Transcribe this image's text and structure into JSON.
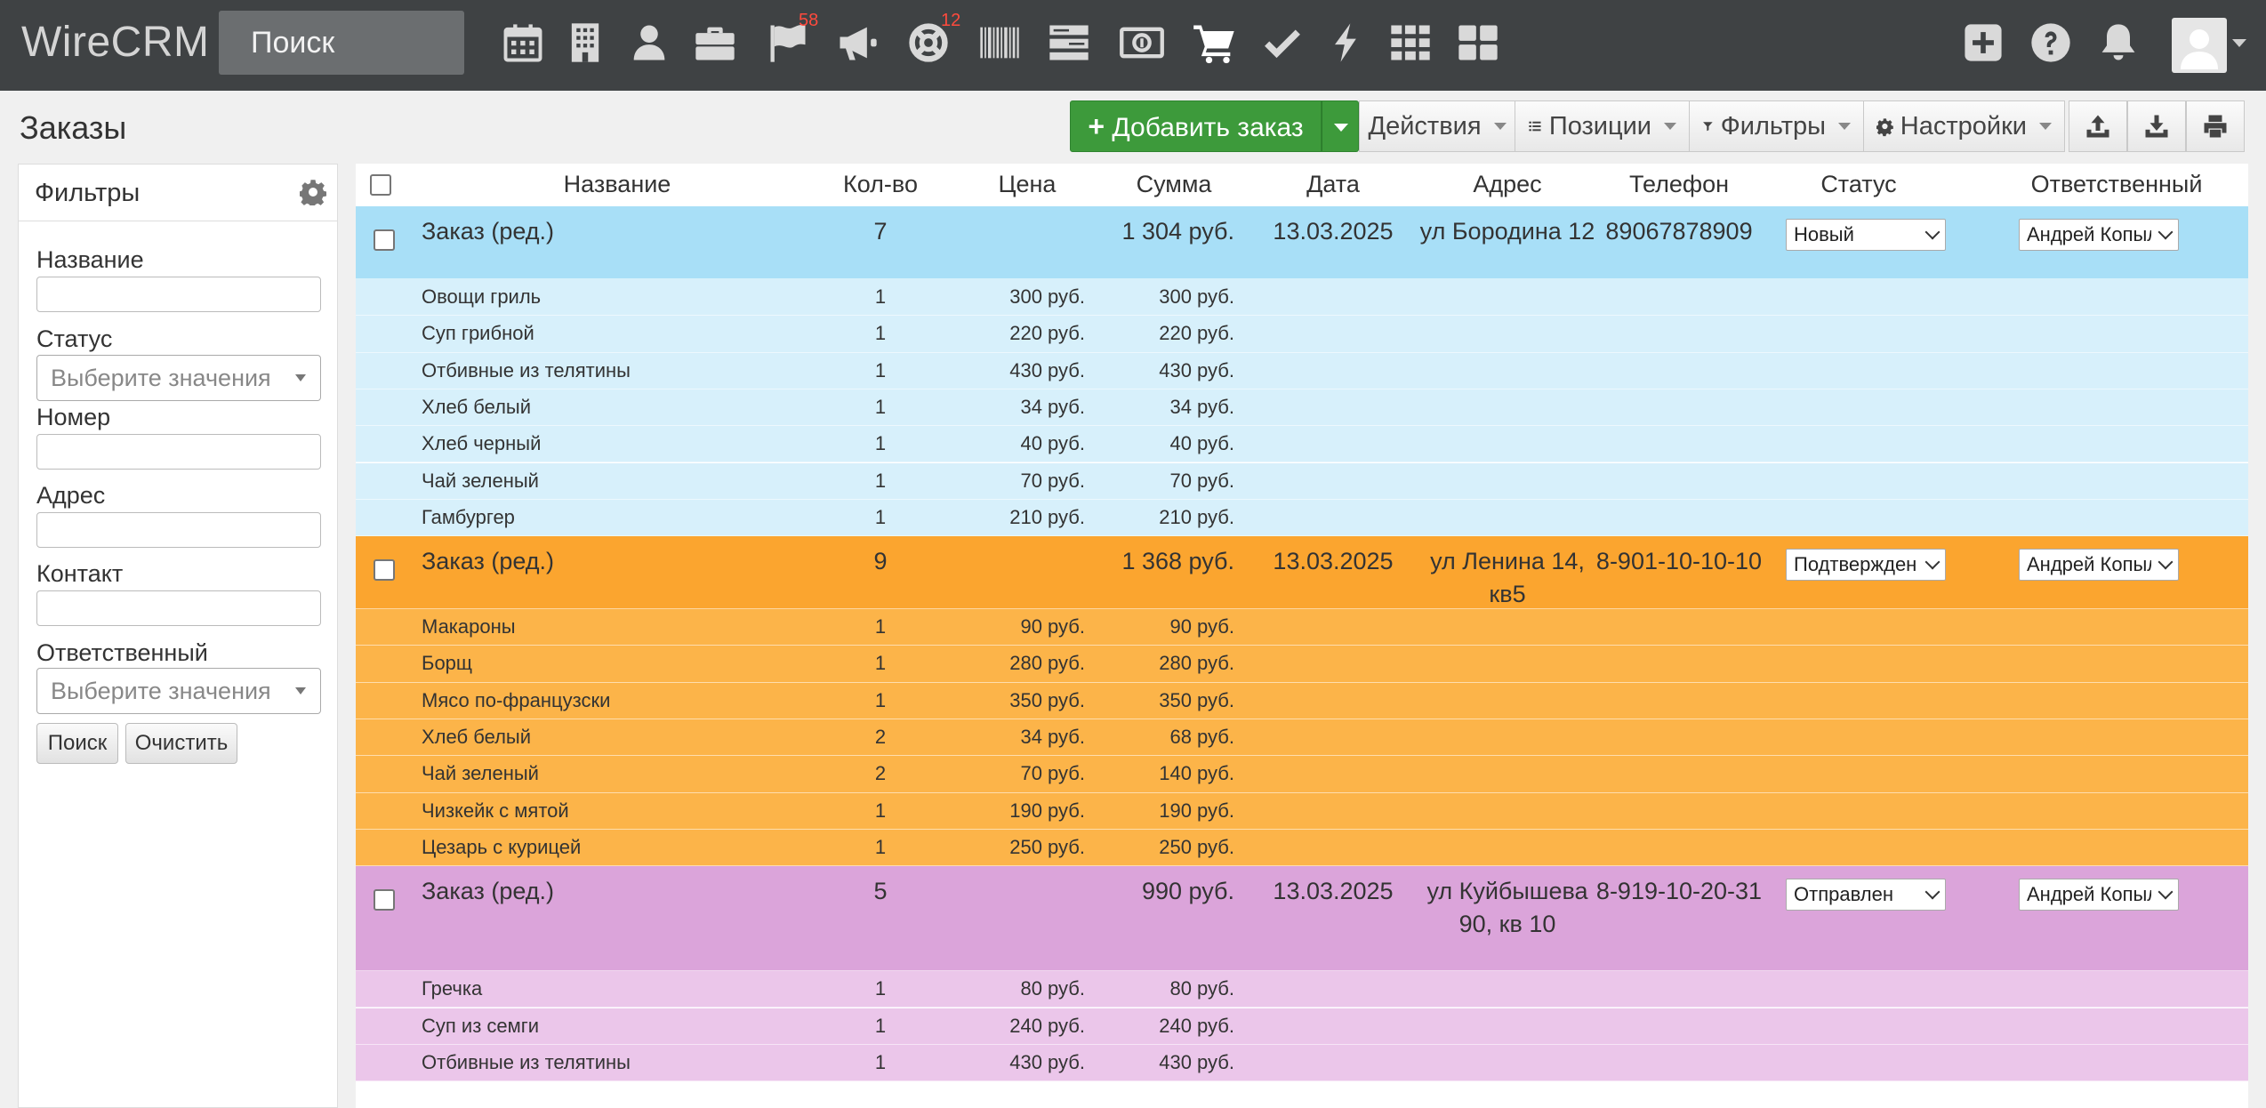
{
  "app": {
    "brand": "WireCRM",
    "search_placeholder": "Поиск"
  },
  "nav": {
    "icons": [
      "calendar-icon",
      "building-icon",
      "user-icon",
      "briefcase-icon",
      "flag-icon",
      "megaphone-icon",
      "lifebuoy-icon",
      "barcode-icon",
      "server-icon",
      "money-icon",
      "cart-icon",
      "check-icon",
      "bolt-icon",
      "grid-icon",
      "dashboard-icon"
    ],
    "badges": {
      "flag": "58",
      "support": "12"
    },
    "right_icons": [
      "plus-icon",
      "help-icon",
      "bell-icon",
      "avatar-icon"
    ]
  },
  "page": {
    "title": "Заказы"
  },
  "toolbar": {
    "add": "Добавить заказ",
    "actions": "Действия",
    "positions": "Позиции",
    "filters": "Фильтры",
    "settings": "Настройки"
  },
  "filters": {
    "title": "Фильтры",
    "name_label": "Название",
    "status_label": "Статус",
    "status_placeholder": "Выберите значения",
    "number_label": "Номер",
    "address_label": "Адрес",
    "contact_label": "Контакт",
    "responsible_label": "Ответственный",
    "responsible_placeholder": "Выберите значения",
    "search_btn": "Поиск",
    "clear_btn": "Очистить"
  },
  "table": {
    "columns": [
      "Название",
      "Кол-во",
      "Цена",
      "Сумма",
      "Дата",
      "Адрес",
      "Телефон",
      "Статус",
      "Ответственный"
    ],
    "orders": [
      {
        "name": "Заказ (ред.)",
        "qty": "7",
        "sum": "1 304 руб.",
        "date": "13.03.2025",
        "address": "ул Бородина 12",
        "phone": "89067878909",
        "status": "Новый",
        "responsible": "Андрей Копылов",
        "color": "#a8dff7",
        "item_color": "#d7f0fb",
        "items": [
          {
            "name": "Овощи гриль",
            "qty": "1",
            "price": "300 руб.",
            "sum": "300 руб."
          },
          {
            "name": "Суп грибной",
            "qty": "1",
            "price": "220 руб.",
            "sum": "220 руб."
          },
          {
            "name": "Отбивные из телятины",
            "qty": "1",
            "price": "430 руб.",
            "sum": "430 руб."
          },
          {
            "name": "Хлеб белый",
            "qty": "1",
            "price": "34 руб.",
            "sum": "34 руб."
          },
          {
            "name": "Хлеб черный",
            "qty": "1",
            "price": "40 руб.",
            "sum": "40 руб."
          },
          {
            "name": "Чай зеленый",
            "qty": "1",
            "price": "70 руб.",
            "sum": "70 руб."
          },
          {
            "name": "Гамбургер",
            "qty": "1",
            "price": "210 руб.",
            "sum": "210 руб."
          }
        ]
      },
      {
        "name": "Заказ (ред.)",
        "qty": "9",
        "sum": "1 368 руб.",
        "date": "13.03.2025",
        "address": "ул Ленина 14, кв5",
        "phone": "8-901-10-10-10",
        "status": "Подтвержден",
        "responsible": "Андрей Копылов",
        "color": "#fba52f",
        "item_color": "#fcb449",
        "items": [
          {
            "name": "Макароны",
            "qty": "1",
            "price": "90 руб.",
            "sum": "90 руб."
          },
          {
            "name": "Борщ",
            "qty": "1",
            "price": "280 руб.",
            "sum": "280 руб."
          },
          {
            "name": "Мясо по-французски",
            "qty": "1",
            "price": "350 руб.",
            "sum": "350 руб."
          },
          {
            "name": "Хлеб белый",
            "qty": "2",
            "price": "34 руб.",
            "sum": "68 руб."
          },
          {
            "name": "Чай зеленый",
            "qty": "2",
            "price": "70 руб.",
            "sum": "140 руб."
          },
          {
            "name": "Чизкейк с мятой",
            "qty": "1",
            "price": "190 руб.",
            "sum": "190 руб."
          },
          {
            "name": "Цезарь с курицей",
            "qty": "1",
            "price": "250 руб.",
            "sum": "250 руб."
          }
        ]
      },
      {
        "name": "Заказ (ред.)",
        "qty": "5",
        "sum": "990 руб.",
        "date": "13.03.2025",
        "address": "ул Куйбышева 90, кв 10",
        "phone": "8-919-10-20-31",
        "status": "Отправлен",
        "responsible": "Андрей Копылов",
        "color": "#dba4da",
        "item_color": "#ebc6ea",
        "items": [
          {
            "name": "Гречка",
            "qty": "1",
            "price": "80 руб.",
            "sum": "80 руб."
          },
          {
            "name": "Суп из семги",
            "qty": "1",
            "price": "240 руб.",
            "sum": "240 руб."
          },
          {
            "name": "Отбивные из телятины",
            "qty": "1",
            "price": "430 руб.",
            "sum": "430 руб."
          }
        ]
      }
    ]
  }
}
